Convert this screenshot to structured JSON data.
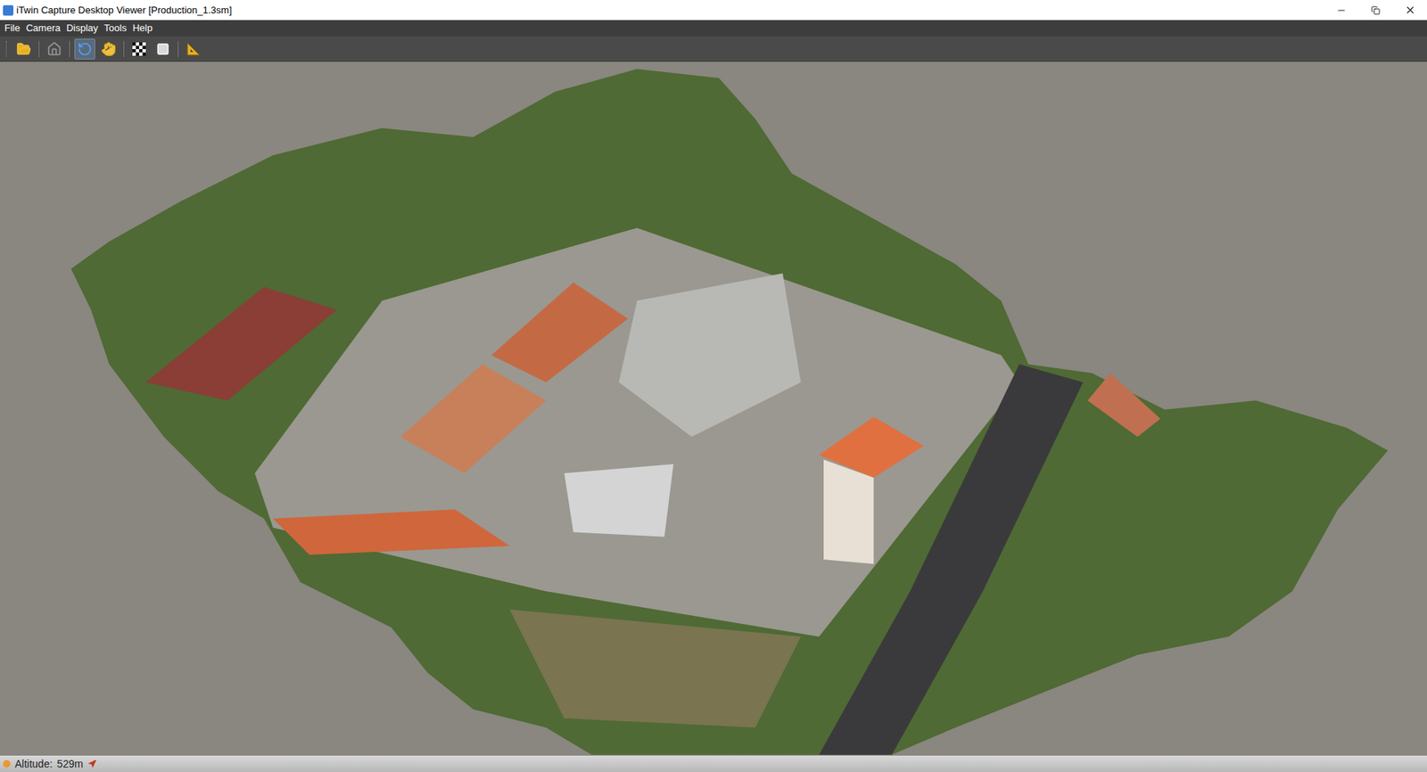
{
  "window": {
    "title": "iTwin Capture Desktop Viewer [Production_1.3sm]"
  },
  "menu": [
    "File",
    "Camera",
    "Display",
    "Tools",
    "Help"
  ],
  "toolbar": [
    {
      "selected": false
    },
    {
      "selected": false
    },
    {
      "selected": true
    },
    {
      "selected": false
    },
    {
      "selected": false
    },
    {
      "selected": false
    },
    {
      "selected": false
    }
  ],
  "status_bar": {
    "label": "Altitude:",
    "value": "529m"
  }
}
